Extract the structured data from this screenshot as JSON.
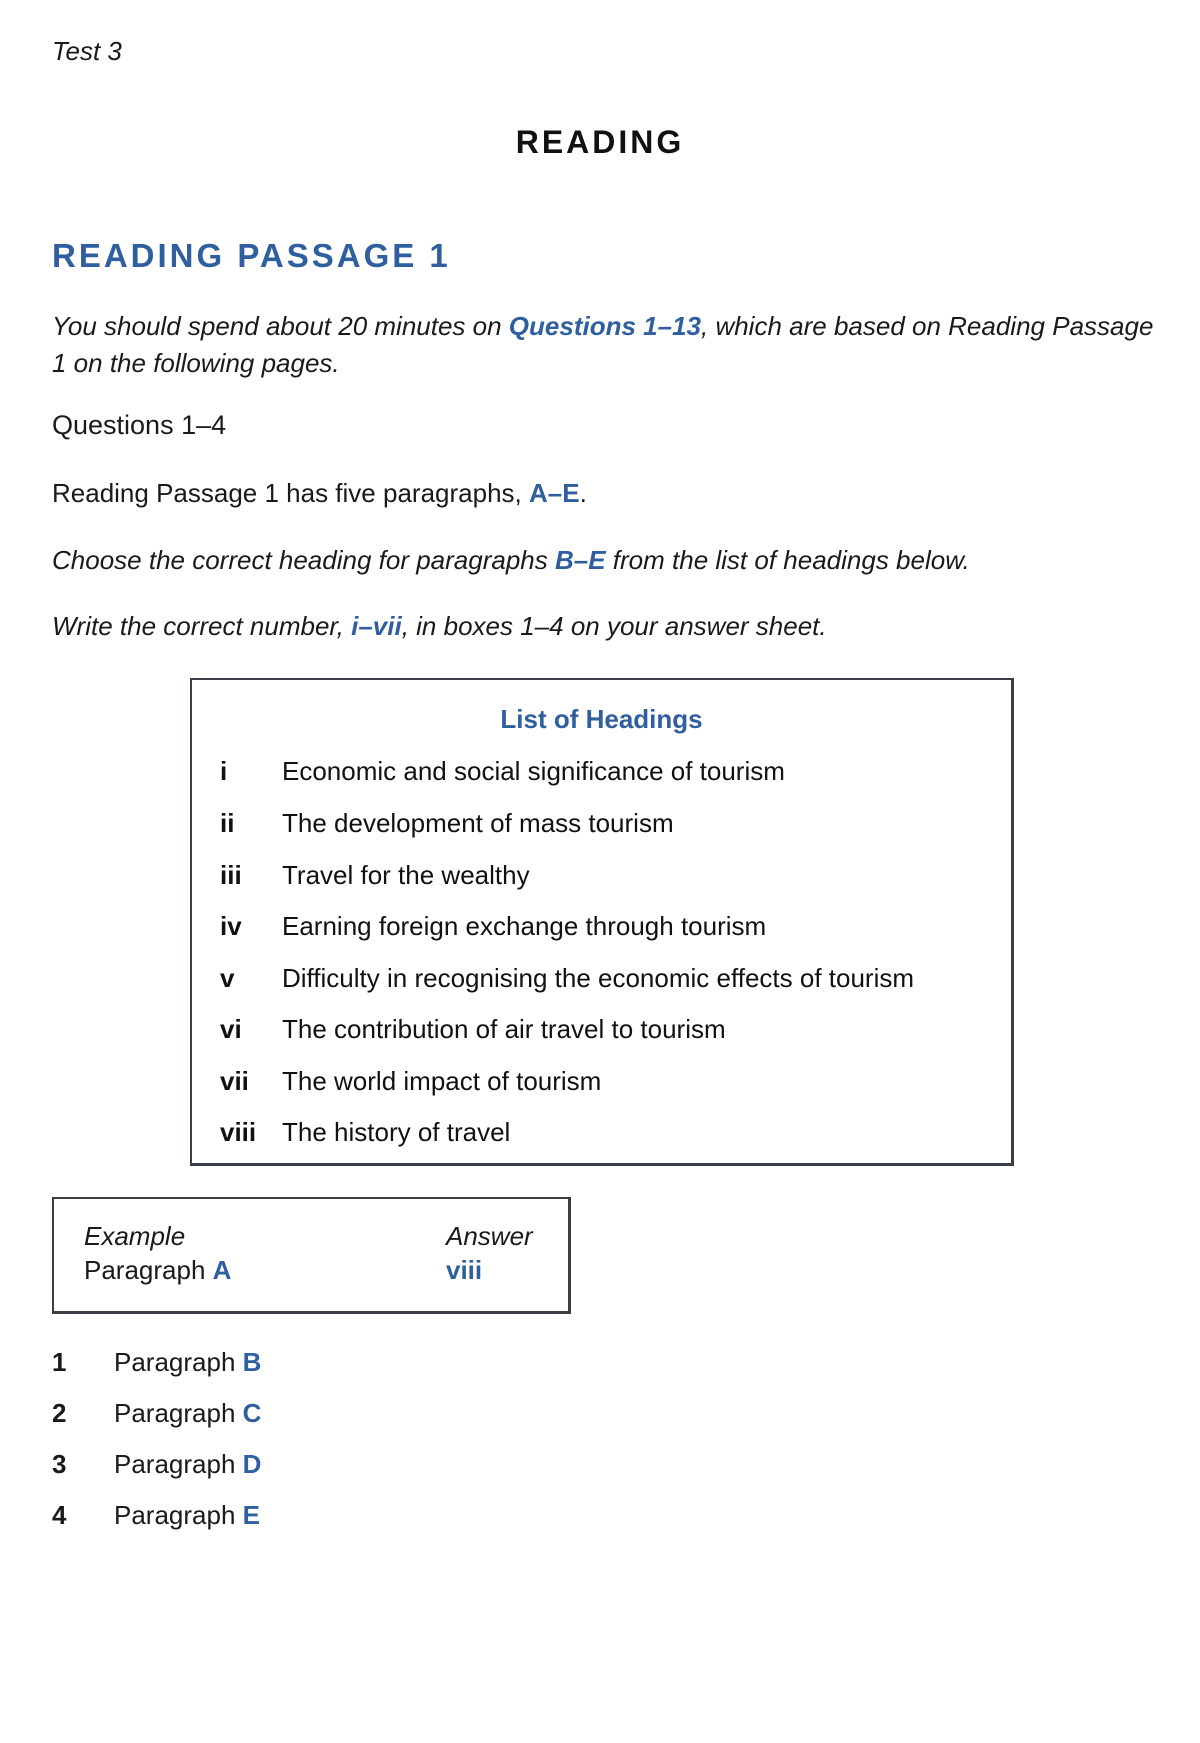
{
  "header": {
    "test_label": "Test 3",
    "section_title": "READING"
  },
  "passage": {
    "title": "READING PASSAGE 1",
    "instruction": {
      "before": "You should spend about 20 minutes on ",
      "highlight": "Questions 1–13",
      "after": ", which are based on Reading Passage 1 on the following pages."
    }
  },
  "questions_block": {
    "range_label": "Questions 1–4",
    "paragraph_count": {
      "before": "Reading Passage 1 has five paragraphs, ",
      "highlight": "A–E",
      "after": "."
    },
    "choose": {
      "before": "Choose the correct heading for paragraphs ",
      "highlight": "B–E",
      "after": " from the list of headings below."
    },
    "write": {
      "before": "Write the correct number, ",
      "highlight": "i–vii",
      "after": ", in boxes 1–4 on your answer sheet."
    }
  },
  "headings_list": {
    "title": "List of Headings",
    "items": [
      {
        "num": "i",
        "text": "Economic and social significance of tourism"
      },
      {
        "num": "ii",
        "text": "The development of mass tourism"
      },
      {
        "num": "iii",
        "text": "Travel for the wealthy"
      },
      {
        "num": "iv",
        "text": "Earning foreign exchange through tourism"
      },
      {
        "num": "v",
        "text": "Difficulty in recognising the economic effects of tourism"
      },
      {
        "num": "vi",
        "text": "The contribution of air travel to tourism"
      },
      {
        "num": "vii",
        "text": "The world impact of tourism"
      },
      {
        "num": "viii",
        "text": "The history of travel"
      }
    ]
  },
  "example": {
    "example_label": "Example",
    "paragraph_label": "Paragraph",
    "paragraph_letter": "A",
    "answer_label": "Answer",
    "answer_value": "viii"
  },
  "questions": [
    {
      "num": "1",
      "label": "Paragraph",
      "letter": "B"
    },
    {
      "num": "2",
      "label": "Paragraph",
      "letter": "C"
    },
    {
      "num": "3",
      "label": "Paragraph",
      "letter": "D"
    },
    {
      "num": "4",
      "label": "Paragraph",
      "letter": "E"
    }
  ],
  "colors": {
    "accent": "#2f5f9e",
    "text": "#1a1a1a",
    "border": "#3a3f47"
  }
}
